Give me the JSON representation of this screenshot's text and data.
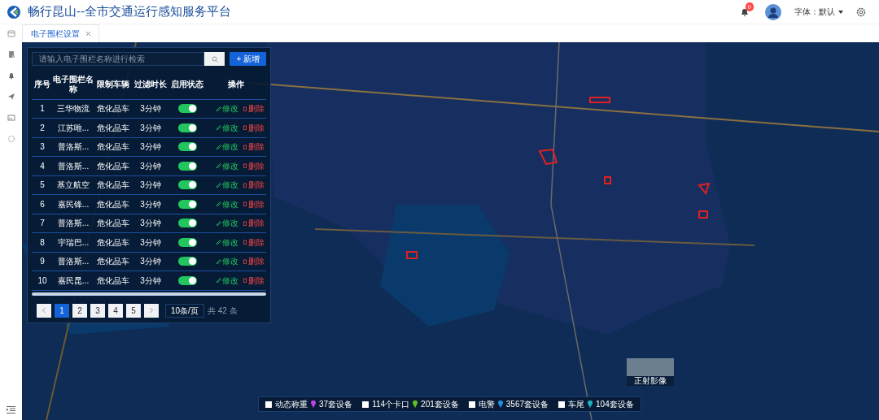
{
  "app": {
    "title": "畅行昆山--全市交通运行感知服务平台",
    "notifications": "0",
    "font_setting": "字体：默认"
  },
  "tabs": [
    {
      "label": "电子围栏设置",
      "selected": true
    }
  ],
  "fence_panel": {
    "search": {
      "placeholder": "请输入电子围栏名称进行检索"
    },
    "add_button": "+ 新增",
    "table": {
      "columns": [
        "序号",
        "电子围栏名称",
        "限制车辆",
        "过滤时长",
        "启用状态",
        "操作"
      ],
      "rows": [
        {
          "index": "1",
          "name": "三华物流",
          "vehicle": "危化品车",
          "duration": "3分钟",
          "on": true,
          "edit": "修改",
          "delete": "删除"
        },
        {
          "index": "2",
          "name": "江苏唯...",
          "vehicle": "危化品车",
          "duration": "3分钟",
          "on": true,
          "edit": "修改",
          "delete": "删除"
        },
        {
          "index": "3",
          "name": "普洛斯...",
          "vehicle": "危化品车",
          "duration": "3分钟",
          "on": true,
          "edit": "修改",
          "delete": "删除"
        },
        {
          "index": "4",
          "name": "普洛斯...",
          "vehicle": "危化品车",
          "duration": "3分钟",
          "on": true,
          "edit": "修改",
          "delete": "删除"
        },
        {
          "index": "5",
          "name": "基立航空",
          "vehicle": "危化品车",
          "duration": "3分钟",
          "on": true,
          "edit": "修改",
          "delete": "删除"
        },
        {
          "index": "6",
          "name": "嘉民锋...",
          "vehicle": "危化品车",
          "duration": "3分钟",
          "on": true,
          "edit": "修改",
          "delete": "删除"
        },
        {
          "index": "7",
          "name": "普洛斯...",
          "vehicle": "危化品车",
          "duration": "3分钟",
          "on": true,
          "edit": "修改",
          "delete": "删除"
        },
        {
          "index": "8",
          "name": "宇瑞巴...",
          "vehicle": "危化品车",
          "duration": "3分钟",
          "on": true,
          "edit": "修改",
          "delete": "删除"
        },
        {
          "index": "9",
          "name": "普洛斯...",
          "vehicle": "危化品车",
          "duration": "3分钟",
          "on": true,
          "edit": "修改",
          "delete": "删除"
        },
        {
          "index": "10",
          "name": "嘉民昆...",
          "vehicle": "危化品车",
          "duration": "3分钟",
          "on": true,
          "edit": "修改",
          "delete": "删除"
        }
      ]
    },
    "pagination": {
      "pages": [
        {
          "label": "1",
          "selected": true
        },
        {
          "label": "2",
          "selected": false
        },
        {
          "label": "3",
          "selected": false
        },
        {
          "label": "4",
          "selected": false
        },
        {
          "label": "5",
          "selected": false
        }
      ],
      "page_size": "10条/页",
      "total": "共 42 条"
    }
  },
  "map_switch": {
    "label": "正射影像"
  },
  "legend": [
    {
      "checked": false,
      "label": "动态称重",
      "color": "#c040e0",
      "count": "37套设备"
    },
    {
      "checked": false,
      "label": "114个卡口",
      "color": "#60c020",
      "count": "201套设备"
    },
    {
      "checked": false,
      "label": "电警",
      "color": "#2090e0",
      "count": "3567套设备"
    },
    {
      "checked": false,
      "label": "车尾",
      "color": "#20b0c0",
      "count": "104套设备"
    }
  ]
}
